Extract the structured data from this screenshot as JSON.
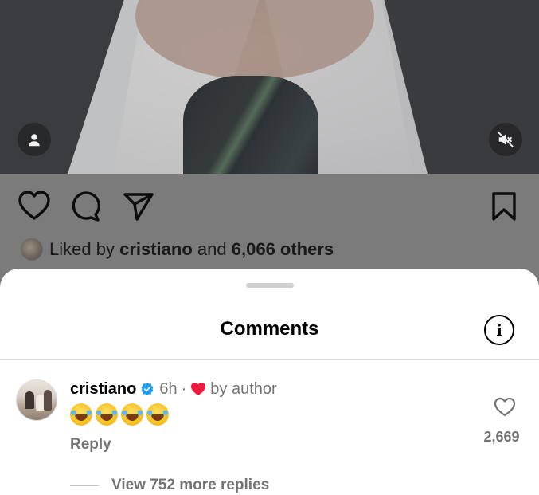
{
  "post": {
    "liked_by_prefix": "Liked by",
    "liked_by_user": "cristiano",
    "liked_by_and": "and",
    "liked_by_others": "6,066 others"
  },
  "icons": {
    "video_user": "person-icon",
    "video_mute": "speaker-muted-icon",
    "like": "heart-outline-icon",
    "comment": "speech-bubble-icon",
    "share": "paper-plane-icon",
    "save": "bookmark-icon"
  },
  "sheet": {
    "title": "Comments",
    "info_icon": "i"
  },
  "comment": {
    "username": "cristiano",
    "time": "6h",
    "separator": "·",
    "liked_by_author": "by author",
    "text_emoji": "face-with-tears-of-joy x4",
    "reply_label": "Reply",
    "like_count": "2,669",
    "view_replies": "View 752 more replies"
  },
  "colors": {
    "author_heart": "#ed1c3f",
    "verified": "#1d9bf0",
    "secondary_text": "#737373"
  }
}
